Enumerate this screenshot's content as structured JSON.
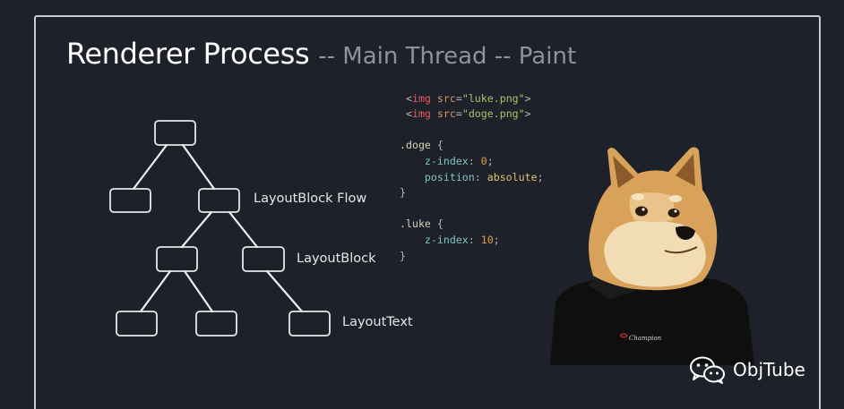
{
  "title": {
    "main": "Renderer Process",
    "sub": "-- Main Thread -- Paint"
  },
  "tree": {
    "labels": {
      "layout_block_flow": "LayoutBlock Flow",
      "layout_block": "LayoutBlock",
      "layout_text": "LayoutText"
    }
  },
  "code": {
    "img1": {
      "tag": "img",
      "attr": "src",
      "value": "\"luke.png\""
    },
    "img2": {
      "tag": "img",
      "attr": "src",
      "value": "\"doge.png\""
    },
    "doge_rule": {
      "selector": ".doge",
      "decls": [
        {
          "prop": "z-index",
          "value": "0"
        },
        {
          "prop": "position",
          "value": "absolute"
        }
      ]
    },
    "luke_rule": {
      "selector": ".luke",
      "decls": [
        {
          "prop": "z-index",
          "value": "10"
        }
      ]
    }
  },
  "image": {
    "description_icon": "doge-in-shirt-icon",
    "shirt_logo_text": "Champion"
  },
  "watermark": {
    "icon": "wechat-icon",
    "label": "ObjTube"
  },
  "colors": {
    "background": "#1e2129",
    "frame": "#c9cbd0",
    "title": "#ffffff",
    "subtitle": "#8d929c"
  }
}
